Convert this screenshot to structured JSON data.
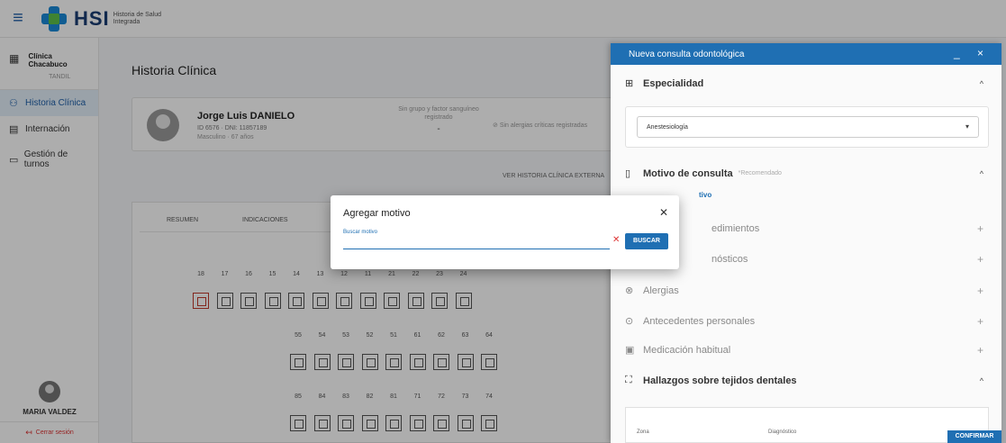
{
  "header": {
    "brand": "HSI",
    "brand_sub": "Historia de Salud Integrada"
  },
  "sidebar": {
    "institution": "Clínica Chacabuco",
    "city": "TANDIL",
    "items": [
      {
        "label": "Historia Clínica",
        "active": true
      },
      {
        "label": "Internación",
        "active": false
      },
      {
        "label": "Gestión de turnos",
        "active": false
      }
    ],
    "user_name": "MARIA VALDEZ",
    "logout": "Cerrar sesión"
  },
  "main": {
    "title": "Historia Clínica",
    "patient": {
      "name": "Jorge Luis DANIELO",
      "id_line": "ID 6576 · DNI: 11857189",
      "sex_age": "Masculino · 67 años",
      "blood_label": "Sin grupo y factor sanguíneo registrado",
      "blood_value": "-",
      "allergies": "Sin alergias críticas registradas"
    },
    "external_link": "VER HISTORIA CLÍNICA EXTERNA",
    "tabs": [
      "RESUMEN",
      "INDICACIONES"
    ],
    "teeth_row1": [
      "18",
      "17",
      "16",
      "15",
      "14",
      "13",
      "12",
      "11",
      "21",
      "22",
      "23",
      "24"
    ],
    "teeth_row2": [
      "55",
      "54",
      "53",
      "52",
      "51",
      "61",
      "62",
      "63",
      "64"
    ],
    "teeth_row3": [
      "85",
      "84",
      "83",
      "82",
      "81",
      "71",
      "72",
      "73",
      "74"
    ]
  },
  "panel": {
    "title": "Nueva consulta odontológica",
    "controls": "_ ×",
    "specialty_label": "Especialidad",
    "specialty_value": "Anestesiología",
    "reason_label": "Motivo de consulta",
    "reason_recommended": "*Recomendado",
    "reason_add": "tivo",
    "procedures": "edimientos",
    "diagnoses": "nósticos",
    "allergies": "Alergias",
    "history": "Antecedentes personales",
    "medication": "Medicación habitual",
    "findings": "Hallazgos sobre tejidos dentales",
    "table_headers": [
      "Zona",
      "Diagnóstico"
    ],
    "confirm": "CONFIRMAR"
  },
  "modal": {
    "title": "Agregar motivo",
    "search_label": "Buscar motivo",
    "search_value": "",
    "search_button": "BUSCAR"
  }
}
